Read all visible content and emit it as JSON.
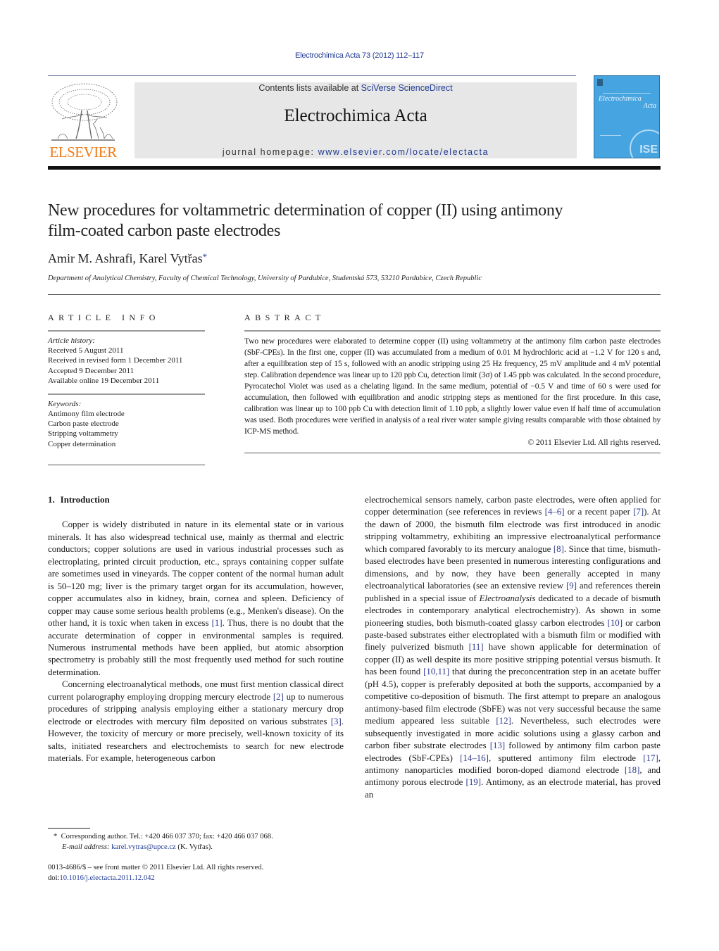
{
  "header": {
    "journal_ref": "Electrochimica Acta 73 (2012) 112–117",
    "contents_prefix": "Contents lists available at ",
    "contents_link": "SciVerse ScienceDirect",
    "journal_title": "Electrochimica Acta",
    "homepage_prefix": "journal homepage: ",
    "homepage_link": "www.elsevier.com/locate/electacta",
    "publisher_logo_text": "ELSEVIER",
    "cover": {
      "title_line1": "Electrochimica",
      "title_line2": "Acta",
      "emblem_text": "ISE",
      "background_color": "#46a4e0"
    }
  },
  "article": {
    "title_line1": "New procedures for voltammetric determination of copper (II) using antimony",
    "title_line2": "film-coated carbon paste electrodes",
    "authors": "Amir M. Ashrafi, Karel Vytřas",
    "author_mark": "*",
    "affiliation": "Department of Analytical Chemistry, Faculty of Chemical Technology, University of Pardubice, Studentská 573, 53210 Pardubice, Czech Republic"
  },
  "article_info": {
    "heading": "ARTICLE INFO",
    "history_label": "Article history:",
    "history": [
      "Received 5 August 2011",
      "Received in revised form 1 December 2011",
      "Accepted 9 December 2011",
      "Available online 19 December 2011"
    ],
    "keywords_label": "Keywords:",
    "keywords": [
      "Antimony film electrode",
      "Carbon paste electrode",
      "Stripping voltammetry",
      "Copper determination"
    ]
  },
  "abstract": {
    "heading": "ABSTRACT",
    "text": "Two new procedures were elaborated to determine copper (II) using voltammetry at the antimony film carbon paste electrodes (SbF-CPEs). In the first one, copper (II) was accumulated from a medium of 0.01 M hydrochloric acid at −1.2 V for 120 s and, after a equilibration step of 15 s, followed with an anodic stripping using 25 Hz frequency, 25 mV amplitude and 4 mV potential step. Calibration dependence was linear up to 120 ppb Cu, detection limit (3σ) of 1.45 ppb was calculated. In the second procedure, Pyrocatechol Violet was used as a chelating ligand. In the same medium, potential of −0.5 V and time of 60 s were used for accumulation, then followed with equilibration and anodic stripping steps as mentioned for the first procedure. In this case, calibration was linear up to 100 ppb Cu with detection limit of 1.10 ppb, a slightly lower value even if half time of accumulation was used. Both procedures were verified in analysis of a real river water sample giving results comparable with those obtained by ICP-MS method.",
    "copyright": "© 2011 Elsevier Ltd. All rights reserved."
  },
  "body": {
    "section_number": "1.",
    "section_title": "Introduction",
    "left": {
      "p1_a": "Copper is widely distributed in nature in its elemental state or in various minerals. It has also widespread technical use, mainly as thermal and electric conductors; copper solutions are used in various industrial processes such as electroplating, printed circuit production, etc., sprays containing copper sulfate are sometimes used in vineyards. The copper content of the normal human adult is 50–120 mg; liver is the primary target organ for its accumulation, however, copper accumulates also in kidney, brain, cornea and spleen. Deficiency of copper may cause some serious health problems (e.g., Menken's disease). On the other hand, it is toxic when taken in excess ",
      "ref1": "[1]",
      "p1_b": ". Thus, there is no doubt that the accurate determination of copper in environmental samples is required. Numerous instrumental methods have been applied, but atomic absorption spectrometry is probably still the most frequently used method for such routine determination.",
      "p2_a": "Concerning electroanalytical methods, one must first mention classical direct current polarography employing dropping mercury electrode ",
      "ref2": "[2]",
      "p2_b": " up to numerous procedures of stripping analysis employing either a stationary mercury drop electrode or electrodes with mercury film deposited on various substrates ",
      "ref3": "[3]",
      "p2_c": ". However, the toxicity of mercury or more precisely, well-known toxicity of its salts, initiated researchers and electrochemists to search for new electrode materials. For example, heterogeneous carbon"
    },
    "right": {
      "t1": "electrochemical sensors namely, carbon paste electrodes, were often applied for copper determination (see references in reviews ",
      "r1": "[4–6]",
      "t2": " or a recent paper ",
      "r2": "[7]",
      "t3": "). At the dawn of 2000, the bismuth film electrode was first introduced in anodic stripping voltammetry, exhibiting an impressive electroanalytical performance which compared favorably to its mercury analogue ",
      "r3": "[8]",
      "t4": ". Since that time, bismuth-based electrodes have been presented in numerous interesting configurations and dimensions, and by now, they have been generally accepted in many electroanalytical laboratories (see an extensive review ",
      "r4": "[9]",
      "t5": " and references therein published in a special issue of ",
      "t5_italic": "Electroanalysis",
      "t6": " dedicated to a decade of bismuth electrodes in contemporary analytical electrochemistry). As shown in some pioneering studies, both bismuth-coated glassy carbon electrodes ",
      "r5": "[10]",
      "t7": " or carbon paste-based substrates either electroplated with a bismuth film or modified with finely pulverized bismuth ",
      "r6": "[11]",
      "t8": " have shown applicable for determination of copper (II) as well despite its more positive stripping potential versus bismuth. It has been found ",
      "r7": "[10,11]",
      "t9": " that during the preconcentration step in an acetate buffer (pH 4.5), copper is preferably deposited at both the supports, accompanied by a competitive co-deposition of bismuth. The first attempt to prepare an analogous antimony-based film electrode (SbFE) was not very successful because the same medium appeared less suitable ",
      "r8": "[12]",
      "t10": ". Nevertheless, such electrodes were subsequently investigated in more acidic solutions using a glassy carbon and carbon fiber substrate electrodes ",
      "r9": "[13]",
      "t11": " followed by antimony film carbon paste electrodes (SbF-CPEs) ",
      "r10": "[14–16]",
      "t12": ", sputtered antimony film electrode ",
      "r11": "[17]",
      "t13": ", antimony nanoparticles modified boron-doped diamond electrode ",
      "r12": "[18]",
      "t14": ", and antimony porous electrode ",
      "r13": "[19]",
      "t15": ". Antimony, as an electrode material, has proved an"
    }
  },
  "footnote": {
    "mark": "*",
    "corresponding": "Corresponding author. Tel.: +420 466 037 370; fax: +420 466 037 068.",
    "email_label": "E-mail address: ",
    "email": "karel.vytras@upce.cz",
    "email_suffix": " (K. Vytřas)."
  },
  "front_matter": {
    "issn_line": "0013-4686/$ – see front matter © 2011 Elsevier Ltd. All rights reserved.",
    "doi_prefix": "doi:",
    "doi": "10.1016/j.electacta.2011.12.042"
  }
}
